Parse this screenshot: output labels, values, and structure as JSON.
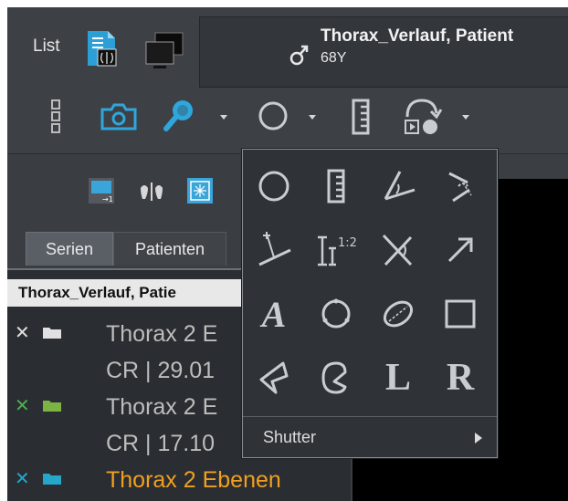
{
  "toolbar": {
    "list_label": "List"
  },
  "patient": {
    "name": "Thorax_Verlauf, Patient",
    "age": "68Y"
  },
  "tabs": [
    {
      "label": "Serien"
    },
    {
      "label": "Patienten"
    }
  ],
  "series_list": {
    "header": "Thorax_Verlauf, Patie",
    "rows": [
      {
        "title": "Thorax 2 E",
        "subtitle": "CR | 29.01",
        "x_color": "#e0e0e0",
        "folder_color": "#e0e0e0"
      },
      {
        "title": "Thorax 2 E",
        "subtitle": "CR | 17.10",
        "x_color": "#4caf50",
        "folder_color": "#7cb342"
      },
      {
        "title": "Thorax 2 Ebenen",
        "x_color": "#26a6c9",
        "folder_color": "#26a6c9",
        "active": true
      }
    ]
  },
  "popup": {
    "tools": [
      {
        "name": "circle-icon"
      },
      {
        "name": "ruler-icon"
      },
      {
        "name": "angle-icon"
      },
      {
        "name": "cobb-angle-icon"
      },
      {
        "name": "perpendicular-icon"
      },
      {
        "name": "ratio-icon",
        "text": "1:2"
      },
      {
        "name": "cross-angle-icon"
      },
      {
        "name": "arrow-icon"
      },
      {
        "name": "text-annotation-icon",
        "text": "A"
      },
      {
        "name": "circle-points-icon"
      },
      {
        "name": "ellipse-icon"
      },
      {
        "name": "rectangle-icon"
      },
      {
        "name": "polygon-icon"
      },
      {
        "name": "freehand-icon"
      },
      {
        "name": "left-marker-icon",
        "text": "L"
      },
      {
        "name": "right-marker-icon",
        "text": "R"
      }
    ],
    "shutter_label": "Shutter"
  },
  "colors": {
    "background": "#3b3f44",
    "active_text": "#f0a020",
    "icon_blue": "#29a3d8"
  }
}
